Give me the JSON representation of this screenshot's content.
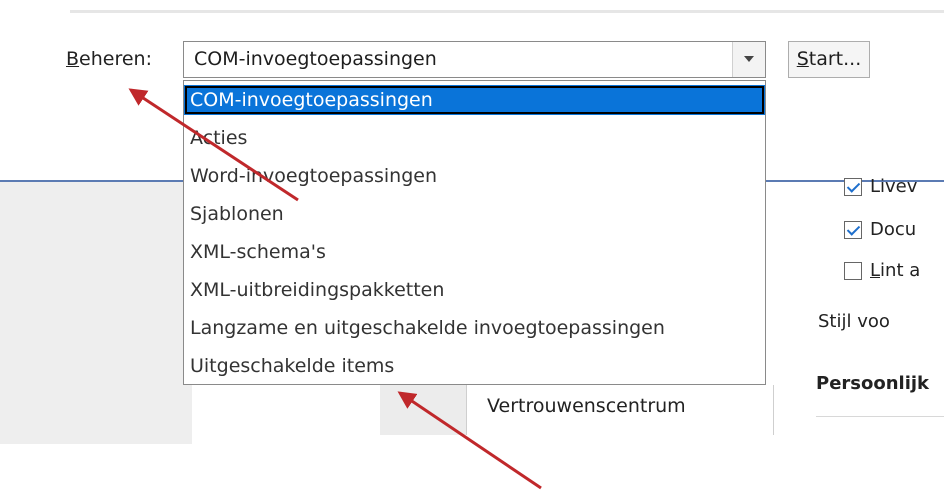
{
  "manage": {
    "label_underlined": "B",
    "label_rest": "eheren:",
    "selected_value": "COM-invoegtoepassingen",
    "start_underlined": "S",
    "start_rest": "tart..."
  },
  "dropdown": {
    "options": [
      "COM-invoegtoepassingen",
      "Acties",
      "Word-invoegtoepassingen",
      "Sjablonen",
      "XML-schema's",
      "XML-uitbreidingspakketten",
      "Langzame en uitgeschakelde invoegtoepassingen",
      "Uitgeschakelde items"
    ]
  },
  "background": {
    "nav_item": "Vertrouwenscentrum",
    "check1": "Livev",
    "check2": "Docu",
    "check3_underlined": "L",
    "check3_rest": "int a",
    "style_text": "Stijl voo",
    "section_heading": "Persoonlijk"
  },
  "colors": {
    "selection": "#0a74d9",
    "annotation_arrow": "#c0282b",
    "window_border": "#5b7bb3"
  },
  "icons": [
    "chevron-down-icon",
    "checkbox-checked-icon",
    "checkbox-unchecked-icon",
    "annotation-arrow-icon"
  ]
}
